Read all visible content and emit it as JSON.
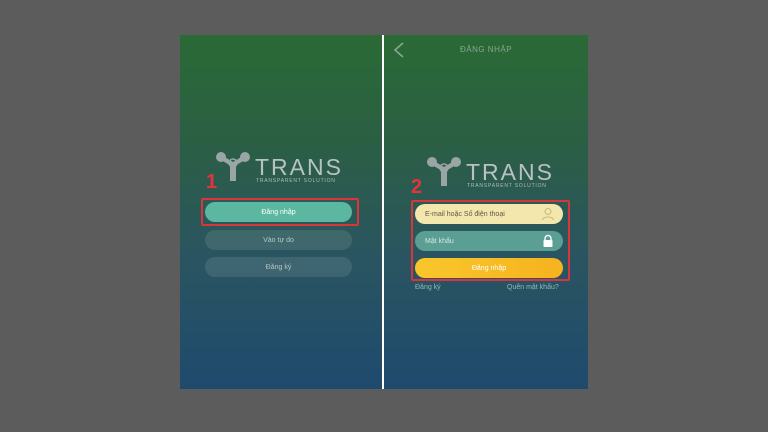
{
  "left_screen": {
    "logo": {
      "text": "TRANS",
      "tagline": "TRANSPARENT SOLUTION"
    },
    "step_label": "1",
    "buttons": {
      "login": "Đăng nhập",
      "guest": "Vào tự do",
      "register": "Đăng ký"
    }
  },
  "right_screen": {
    "header": {
      "title": "ĐĂNG NHẬP",
      "back_icon": "chevron-left-icon"
    },
    "logo": {
      "text": "TRANS",
      "tagline": "TRANSPARENT SOLUTION"
    },
    "step_label": "2",
    "email_field": {
      "placeholder": "E-mail hoặc Số điện thoại",
      "icon": "user-icon"
    },
    "password_field": {
      "placeholder": "Mật khẩu",
      "icon": "lock-icon"
    },
    "login_button": "Đăng nhập",
    "register_link": "Đăng ký",
    "forgot_link": "Quên mật khẩu?"
  },
  "colors": {
    "background": "#5c5c5c",
    "highlight": "#d8363a",
    "primary_button": "#5bb79f",
    "login_button": "#f8c72c",
    "email_field": "#f3e7ad"
  }
}
